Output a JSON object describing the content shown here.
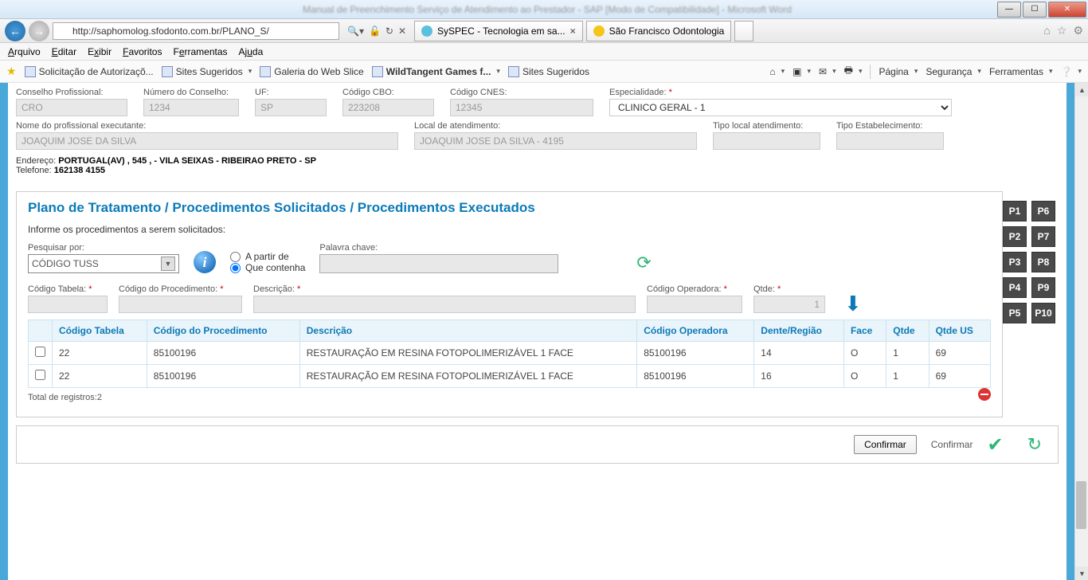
{
  "window": {
    "faded_title": "Manual de Preenchimento Serviço de Atendimento ao Prestador - SAP [Modo de Compatibilidade] - Microsoft Word"
  },
  "browser": {
    "url": "http://saphomolog.sfodonto.com.br/PLANO_S/",
    "tabs": [
      {
        "label": "SySPEC - Tecnologia em sa...",
        "closable": true
      },
      {
        "label": "São Francisco Odontologia",
        "closable": false
      }
    ]
  },
  "menubar": [
    "Arquivo",
    "Editar",
    "Exibir",
    "Favoritos",
    "Ferramentas",
    "Ajuda"
  ],
  "favbar": {
    "items": [
      "Solicitação de Autorizaçõ...",
      "Sites Sugeridos",
      "Galeria do Web Slice",
      "WildTangent Games f...",
      "Sites Sugeridos"
    ],
    "right": [
      "Página",
      "Segurança",
      "Ferramentas"
    ]
  },
  "form": {
    "conselho_label": "Conselho Profissional:",
    "conselho": "CRO",
    "numero_label": "Número do Conselho:",
    "numero": "1234",
    "uf_label": "UF:",
    "uf": "SP",
    "cbo_label": "Código CBO:",
    "cbo": "223208",
    "cnes_label": "Código CNES:",
    "cnes": "12345",
    "espec_label": "Especialidade: ",
    "espec_req": "*",
    "espec": "CLINICO GERAL - 1",
    "nome_label": "Nome do profissional executante:",
    "nome": "JOAQUIM JOSE DA SILVA",
    "local_label": "Local de atendimento:",
    "local": "JOAQUIM JOSE DA SILVA - 4195",
    "tipolocal_label": "Tipo local atendimento:",
    "tipoestab_label": "Tipo Estabelecimento:",
    "endereco_lbl": "Endereço: ",
    "endereco": "PORTUGAL(AV) , 545 , - VILA SEIXAS - RIBEIRAO PRETO - SP",
    "telefone_lbl": "Telefone: ",
    "telefone": "162138 4155"
  },
  "section": {
    "title": "Plano de Tratamento / Procedimentos Solicitados / Procedimentos Executados",
    "instr": "Informe os procedimentos a serem solicitados:",
    "pesq_label": "Pesquisar por:",
    "pesq_value": "CÓDIGO TUSS",
    "radio1": "A partir de",
    "radio2": "Que contenha",
    "palavra_label": "Palavra chave:",
    "codtab_label": "Código Tabela: ",
    "req": "*",
    "codproc_label": "Código do Procedimento: ",
    "desc_label": "Descrição: ",
    "codop_label": "Código Operadora: ",
    "qtde_label": "Qtde: ",
    "qtde_val": "1",
    "cols": [
      "Código Tabela",
      "Código do Procedimento",
      "Descrição",
      "Código Operadora",
      "Dente/Região",
      "Face",
      "Qtde",
      "Qtde US"
    ],
    "rows": [
      {
        "codtab": "22",
        "codproc": "85100196",
        "desc": "RESTAURAÇÃO EM RESINA FOTOPOLIMERIZÁVEL 1 FACE",
        "codop": "85100196",
        "dente": "14",
        "face": "O",
        "qtde": "1",
        "qtdeus": "69"
      },
      {
        "codtab": "22",
        "codproc": "85100196",
        "desc": "RESTAURAÇÃO EM RESINA FOTOPOLIMERIZÁVEL 1 FACE",
        "codop": "85100196",
        "dente": "16",
        "face": "O",
        "qtde": "1",
        "qtdeus": "69"
      }
    ],
    "total": "Total de registros:2"
  },
  "pbuttons": [
    "P1",
    "P6",
    "P2",
    "P7",
    "P3",
    "P8",
    "P4",
    "P9",
    "P5",
    "P10"
  ],
  "confirm": {
    "btn": "Confirmar",
    "lbl": "Confirmar"
  }
}
